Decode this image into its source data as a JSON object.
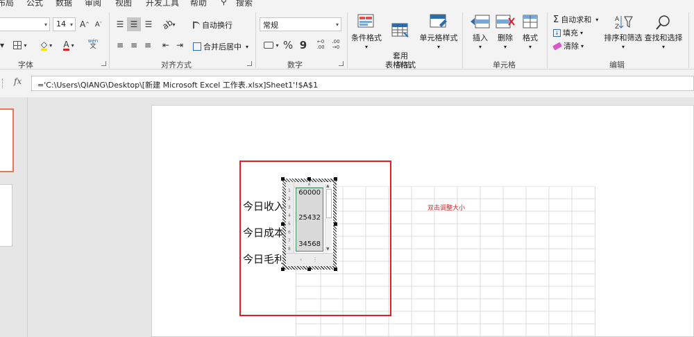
{
  "menu": {
    "items": [
      "布局",
      "公式",
      "数据",
      "审阅",
      "视图",
      "开发工具",
      "帮助"
    ],
    "search_label": "搜索"
  },
  "ribbon": {
    "font_group": {
      "label": "字体",
      "font_size": "14",
      "grow_label": "A",
      "shrink_label": "A",
      "font_color_label": "A",
      "wen_label": "wén",
      "wen_char": "文"
    },
    "align_group": {
      "label": "对齐方式",
      "wrap_label": "自动换行",
      "merge_label": "合并后居中"
    },
    "number_group": {
      "label": "数字",
      "format_value": "常规",
      "percent_label": "%",
      "comma_label": "9",
      "inc_label": "←0 .00",
      "dec_label": ".00 →0"
    },
    "styles_group": {
      "label": "样式",
      "cond_format_label": "条件格式",
      "table_format_label": "套用\n表格格式",
      "cell_style_label": "单元格样式"
    },
    "cells_group": {
      "label": "单元格",
      "insert_label": "插入",
      "delete_label": "删除",
      "format_label": "格式"
    },
    "edit_group": {
      "label": "编辑",
      "autosum_label": "自动求和",
      "fill_label": "填充",
      "clear_label": "清除",
      "sort_label": "排序和筛选",
      "find_label": "查找和选择"
    }
  },
  "formula_bar": {
    "fx_label": "fx",
    "formula": "='C:\\Users\\QIANG\\Desktop\\[新建 Microsoft Excel 工作表.xlsx]Sheet1'!$A$1"
  },
  "slide": {
    "labels": [
      "今日收入",
      "今日成本",
      "今日毛利"
    ],
    "hint": "双击调整大小"
  },
  "embedded_sheet": {
    "col_header": "A",
    "row_numbers": [
      "1",
      "2",
      "3",
      "4",
      "5",
      "6",
      "7",
      "8"
    ],
    "values": [
      "60000",
      "25432",
      "34568"
    ]
  },
  "colors": {
    "accent_red": "#e02020",
    "selection_green": "#3a8f5c",
    "thumb_border": "#e8764e"
  }
}
